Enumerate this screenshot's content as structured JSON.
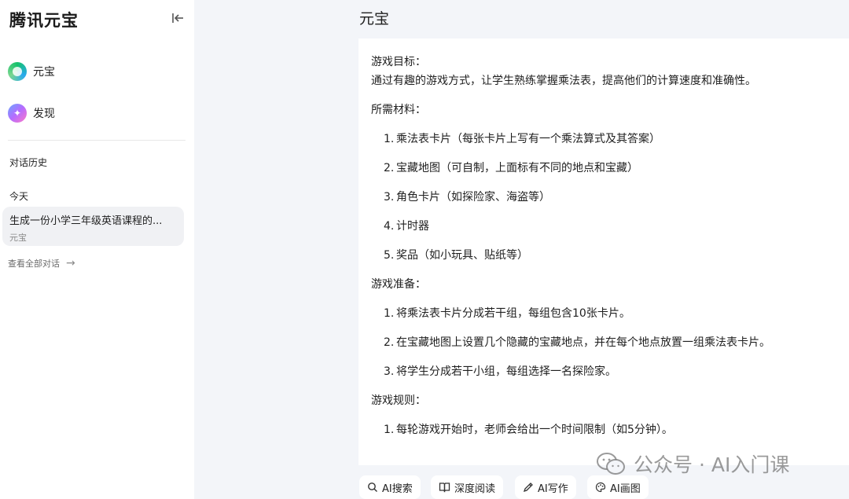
{
  "sidebar": {
    "brand": "腾讯元宝",
    "nav": [
      {
        "label": "元宝",
        "icon": "yuanbao-logo-icon"
      },
      {
        "label": "发现",
        "icon": "discover-sparkle-icon"
      }
    ],
    "history_title": "对话历史",
    "today_label": "今天",
    "history_items": [
      {
        "title": "生成一份小学三年级英语课程的...",
        "subtitle": "元宝"
      }
    ],
    "view_all": "查看全部对话"
  },
  "main": {
    "title": "元宝",
    "content": {
      "goal_heading": "游戏目标：",
      "goal_text": "通过有趣的游戏方式，让学生熟练掌握乘法表，提高他们的计算速度和准确性。",
      "materials_heading": "所需材料：",
      "materials": [
        "乘法表卡片（每张卡片上写有一个乘法算式及其答案）",
        "宝藏地图（可自制，上面标有不同的地点和宝藏）",
        "角色卡片（如探险家、海盗等）",
        "计时器",
        "奖品（如小玩具、贴纸等）"
      ],
      "prep_heading": "游戏准备：",
      "prep": [
        "将乘法表卡片分成若干组，每组包含10张卡片。",
        "在宝藏地图上设置几个隐藏的宝藏地点，并在每个地点放置一组乘法表卡片。",
        "将学生分成若干小组，每组选择一名探险家。"
      ],
      "rules_heading": "游戏规则：",
      "rules": [
        "每轮游戏开始时，老师会给出一个时间限制（如5分钟）。"
      ]
    },
    "tools": [
      {
        "label": "AI搜索",
        "icon": "search-icon"
      },
      {
        "label": "深度阅读",
        "icon": "book-icon"
      },
      {
        "label": "AI写作",
        "icon": "pen-icon"
      },
      {
        "label": "AI画图",
        "icon": "palette-icon"
      }
    ]
  },
  "watermark": {
    "text": "公众号 · AI入门课"
  }
}
